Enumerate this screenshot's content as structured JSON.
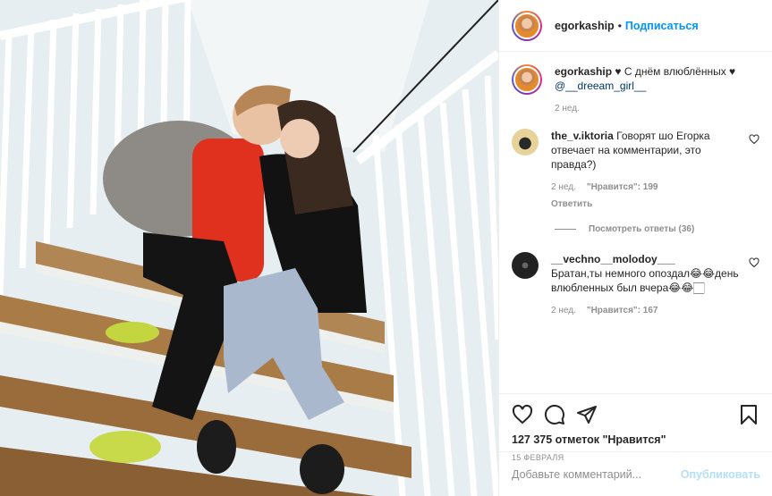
{
  "header": {
    "username": "egorkaship",
    "dot": "•",
    "follow_label": "Подписаться",
    "avatar_icon": "profile-avatar"
  },
  "caption": {
    "username": "egorkaship",
    "text": "♥ С днём влюблённых ♥",
    "mention": "@__dreeam_girl__",
    "time": "2 нед."
  },
  "comments": [
    {
      "username": "the_v.iktoria",
      "text": "Говорят шо Егорка отвечает на комментарии, это правда?)",
      "time": "2 нед.",
      "likes": "\"Нравится\": 199",
      "reply_label": "Ответить",
      "view_replies": "Посмотреть ответы (36)",
      "avatar_icon": "cat-avatar"
    },
    {
      "username": "__vechno__molodoy___",
      "text": "Братан,ты немного опоздал😂😂день влюбленных был вчера😂😂🏻",
      "time": "2 нед.",
      "likes": "\"Нравится\": 167",
      "avatar_icon": "dark-avatar"
    }
  ],
  "actions": {
    "icons": [
      "heart-icon",
      "comment-icon",
      "share-icon",
      "bookmark-icon"
    ],
    "like_count": "127 375 отметок \"Нравится\"",
    "date": "15 ФЕВРАЛЯ"
  },
  "add_comment": {
    "placeholder": "Добавьте комментарий...",
    "publish_label": "Опубликовать"
  },
  "colors": {
    "accent": "#0095f6",
    "publish_disabled": "#b2dffc",
    "muted": "#8e8e8e",
    "text": "#262626",
    "mention": "#00376b"
  }
}
